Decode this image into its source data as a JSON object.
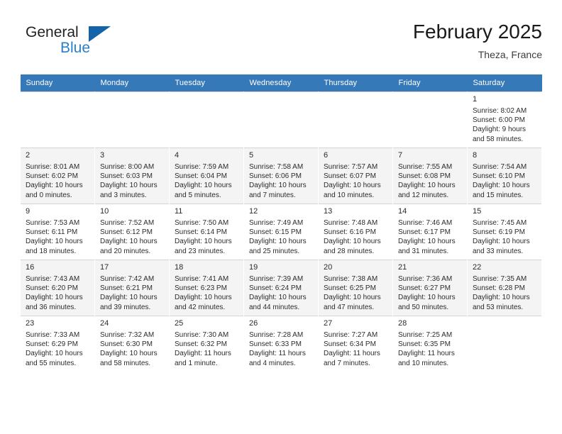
{
  "brand": {
    "general": "General",
    "blue": "Blue",
    "triangle_color": "#1263a8",
    "blue_color": "#2a7fc9"
  },
  "header": {
    "title": "February 2025",
    "subtitle": "Theza, France"
  },
  "theme": {
    "header_bg": "#3679b8",
    "header_fg": "#ffffff",
    "shaded_row_bg": "#f4f4f4",
    "grid_line": "#d4d4d4"
  },
  "weekdays": [
    "Sunday",
    "Monday",
    "Tuesday",
    "Wednesday",
    "Thursday",
    "Friday",
    "Saturday"
  ],
  "weeks": [
    [
      {
        "day": "",
        "sunrise": "",
        "sunset": "",
        "daylight1": "",
        "daylight2": ""
      },
      {
        "day": "",
        "sunrise": "",
        "sunset": "",
        "daylight1": "",
        "daylight2": ""
      },
      {
        "day": "",
        "sunrise": "",
        "sunset": "",
        "daylight1": "",
        "daylight2": ""
      },
      {
        "day": "",
        "sunrise": "",
        "sunset": "",
        "daylight1": "",
        "daylight2": ""
      },
      {
        "day": "",
        "sunrise": "",
        "sunset": "",
        "daylight1": "",
        "daylight2": ""
      },
      {
        "day": "",
        "sunrise": "",
        "sunset": "",
        "daylight1": "",
        "daylight2": ""
      },
      {
        "day": "1",
        "sunrise": "Sunrise: 8:02 AM",
        "sunset": "Sunset: 6:00 PM",
        "daylight1": "Daylight: 9 hours",
        "daylight2": "and 58 minutes."
      }
    ],
    [
      {
        "day": "2",
        "sunrise": "Sunrise: 8:01 AM",
        "sunset": "Sunset: 6:02 PM",
        "daylight1": "Daylight: 10 hours",
        "daylight2": "and 0 minutes."
      },
      {
        "day": "3",
        "sunrise": "Sunrise: 8:00 AM",
        "sunset": "Sunset: 6:03 PM",
        "daylight1": "Daylight: 10 hours",
        "daylight2": "and 3 minutes."
      },
      {
        "day": "4",
        "sunrise": "Sunrise: 7:59 AM",
        "sunset": "Sunset: 6:04 PM",
        "daylight1": "Daylight: 10 hours",
        "daylight2": "and 5 minutes."
      },
      {
        "day": "5",
        "sunrise": "Sunrise: 7:58 AM",
        "sunset": "Sunset: 6:06 PM",
        "daylight1": "Daylight: 10 hours",
        "daylight2": "and 7 minutes."
      },
      {
        "day": "6",
        "sunrise": "Sunrise: 7:57 AM",
        "sunset": "Sunset: 6:07 PM",
        "daylight1": "Daylight: 10 hours",
        "daylight2": "and 10 minutes."
      },
      {
        "day": "7",
        "sunrise": "Sunrise: 7:55 AM",
        "sunset": "Sunset: 6:08 PM",
        "daylight1": "Daylight: 10 hours",
        "daylight2": "and 12 minutes."
      },
      {
        "day": "8",
        "sunrise": "Sunrise: 7:54 AM",
        "sunset": "Sunset: 6:10 PM",
        "daylight1": "Daylight: 10 hours",
        "daylight2": "and 15 minutes."
      }
    ],
    [
      {
        "day": "9",
        "sunrise": "Sunrise: 7:53 AM",
        "sunset": "Sunset: 6:11 PM",
        "daylight1": "Daylight: 10 hours",
        "daylight2": "and 18 minutes."
      },
      {
        "day": "10",
        "sunrise": "Sunrise: 7:52 AM",
        "sunset": "Sunset: 6:12 PM",
        "daylight1": "Daylight: 10 hours",
        "daylight2": "and 20 minutes."
      },
      {
        "day": "11",
        "sunrise": "Sunrise: 7:50 AM",
        "sunset": "Sunset: 6:14 PM",
        "daylight1": "Daylight: 10 hours",
        "daylight2": "and 23 minutes."
      },
      {
        "day": "12",
        "sunrise": "Sunrise: 7:49 AM",
        "sunset": "Sunset: 6:15 PM",
        "daylight1": "Daylight: 10 hours",
        "daylight2": "and 25 minutes."
      },
      {
        "day": "13",
        "sunrise": "Sunrise: 7:48 AM",
        "sunset": "Sunset: 6:16 PM",
        "daylight1": "Daylight: 10 hours",
        "daylight2": "and 28 minutes."
      },
      {
        "day": "14",
        "sunrise": "Sunrise: 7:46 AM",
        "sunset": "Sunset: 6:17 PM",
        "daylight1": "Daylight: 10 hours",
        "daylight2": "and 31 minutes."
      },
      {
        "day": "15",
        "sunrise": "Sunrise: 7:45 AM",
        "sunset": "Sunset: 6:19 PM",
        "daylight1": "Daylight: 10 hours",
        "daylight2": "and 33 minutes."
      }
    ],
    [
      {
        "day": "16",
        "sunrise": "Sunrise: 7:43 AM",
        "sunset": "Sunset: 6:20 PM",
        "daylight1": "Daylight: 10 hours",
        "daylight2": "and 36 minutes."
      },
      {
        "day": "17",
        "sunrise": "Sunrise: 7:42 AM",
        "sunset": "Sunset: 6:21 PM",
        "daylight1": "Daylight: 10 hours",
        "daylight2": "and 39 minutes."
      },
      {
        "day": "18",
        "sunrise": "Sunrise: 7:41 AM",
        "sunset": "Sunset: 6:23 PM",
        "daylight1": "Daylight: 10 hours",
        "daylight2": "and 42 minutes."
      },
      {
        "day": "19",
        "sunrise": "Sunrise: 7:39 AM",
        "sunset": "Sunset: 6:24 PM",
        "daylight1": "Daylight: 10 hours",
        "daylight2": "and 44 minutes."
      },
      {
        "day": "20",
        "sunrise": "Sunrise: 7:38 AM",
        "sunset": "Sunset: 6:25 PM",
        "daylight1": "Daylight: 10 hours",
        "daylight2": "and 47 minutes."
      },
      {
        "day": "21",
        "sunrise": "Sunrise: 7:36 AM",
        "sunset": "Sunset: 6:27 PM",
        "daylight1": "Daylight: 10 hours",
        "daylight2": "and 50 minutes."
      },
      {
        "day": "22",
        "sunrise": "Sunrise: 7:35 AM",
        "sunset": "Sunset: 6:28 PM",
        "daylight1": "Daylight: 10 hours",
        "daylight2": "and 53 minutes."
      }
    ],
    [
      {
        "day": "23",
        "sunrise": "Sunrise: 7:33 AM",
        "sunset": "Sunset: 6:29 PM",
        "daylight1": "Daylight: 10 hours",
        "daylight2": "and 55 minutes."
      },
      {
        "day": "24",
        "sunrise": "Sunrise: 7:32 AM",
        "sunset": "Sunset: 6:30 PM",
        "daylight1": "Daylight: 10 hours",
        "daylight2": "and 58 minutes."
      },
      {
        "day": "25",
        "sunrise": "Sunrise: 7:30 AM",
        "sunset": "Sunset: 6:32 PM",
        "daylight1": "Daylight: 11 hours",
        "daylight2": "and 1 minute."
      },
      {
        "day": "26",
        "sunrise": "Sunrise: 7:28 AM",
        "sunset": "Sunset: 6:33 PM",
        "daylight1": "Daylight: 11 hours",
        "daylight2": "and 4 minutes."
      },
      {
        "day": "27",
        "sunrise": "Sunrise: 7:27 AM",
        "sunset": "Sunset: 6:34 PM",
        "daylight1": "Daylight: 11 hours",
        "daylight2": "and 7 minutes."
      },
      {
        "day": "28",
        "sunrise": "Sunrise: 7:25 AM",
        "sunset": "Sunset: 6:35 PM",
        "daylight1": "Daylight: 11 hours",
        "daylight2": "and 10 minutes."
      },
      {
        "day": "",
        "sunrise": "",
        "sunset": "",
        "daylight1": "",
        "daylight2": ""
      }
    ]
  ]
}
